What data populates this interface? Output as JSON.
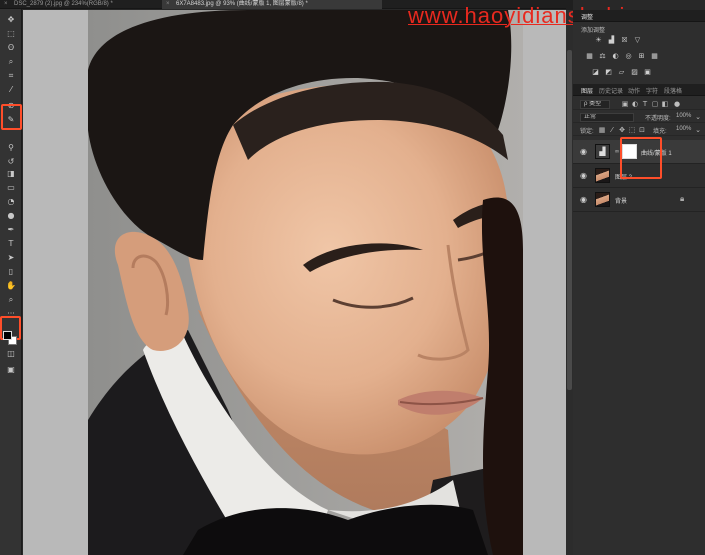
{
  "tabs": [
    {
      "title": "DSC_2879 (2).jpg @ 234%(RGB/8) *",
      "active": false
    },
    {
      "title": "6X7A8483.jpg @ 93% (曲线/蒙版 1, 图层蒙版/8) *",
      "active": true
    }
  ],
  "watermark": "www.haoyidianshehi.com",
  "tools": [
    {
      "name": "move-tool",
      "glyph": "✥"
    },
    {
      "name": "marquee-tool",
      "glyph": "⬚"
    },
    {
      "name": "lasso-tool",
      "glyph": "ʘ"
    },
    {
      "name": "quick-select-tool",
      "glyph": "⌕"
    },
    {
      "name": "crop-tool",
      "glyph": "⌗"
    },
    {
      "name": "eyedropper-tool",
      "glyph": "⁄"
    },
    {
      "name": "healing-tool",
      "glyph": "⊘"
    },
    {
      "name": "brush-tool",
      "glyph": "✎"
    },
    {
      "name": "clone-stamp-tool",
      "glyph": "⚲"
    },
    {
      "name": "history-brush-tool",
      "glyph": "↺"
    },
    {
      "name": "eraser-tool",
      "glyph": "◨"
    },
    {
      "name": "gradient-tool",
      "glyph": "▭"
    },
    {
      "name": "blur-tool",
      "glyph": "◔"
    },
    {
      "name": "dodge-tool",
      "glyph": "●"
    },
    {
      "name": "pen-tool",
      "glyph": "✒"
    },
    {
      "name": "type-tool",
      "glyph": "T"
    },
    {
      "name": "path-select-tool",
      "glyph": "➤"
    },
    {
      "name": "shape-tool",
      "glyph": "▯"
    },
    {
      "name": "hand-tool",
      "glyph": "✋"
    },
    {
      "name": "zoom-tool",
      "glyph": "⌕"
    },
    {
      "name": "more-tools",
      "glyph": "···"
    },
    {
      "name": "quick-mask-tool",
      "glyph": "◫"
    },
    {
      "name": "screen-mode-tool",
      "glyph": "▣"
    }
  ],
  "adjustments": {
    "tab_label": "调整",
    "add_label": "添加调整",
    "row1": [
      "☀",
      "▟",
      "☒",
      "▽"
    ],
    "row2": [
      "▦",
      "⚖",
      "◐",
      "◎",
      "⊞",
      "▦"
    ],
    "row3": [
      "◪",
      "◩",
      "▱",
      "▨",
      "▣"
    ]
  },
  "layers_panel": {
    "tabs": [
      "图层",
      "历史记录",
      "动作",
      "字符",
      "段落格"
    ],
    "kind_label": "ρ 类型",
    "blend_mode": "正常",
    "opacity_label": "不透明度:",
    "opacity_value": "100%",
    "lock_label": "锁定:",
    "fill_label": "填充:",
    "fill_value": "100%",
    "layers": [
      {
        "name": "曲线/蒙版 1",
        "visible": true,
        "selected": true,
        "type": "adjustment"
      },
      {
        "name": "图层 2",
        "visible": true,
        "selected": false,
        "type": "photo"
      },
      {
        "name": "背景",
        "visible": true,
        "selected": false,
        "type": "photo",
        "locked": true
      }
    ]
  },
  "colors": {
    "highlight": "#ff4e2a",
    "watermark": "#e8291f"
  }
}
